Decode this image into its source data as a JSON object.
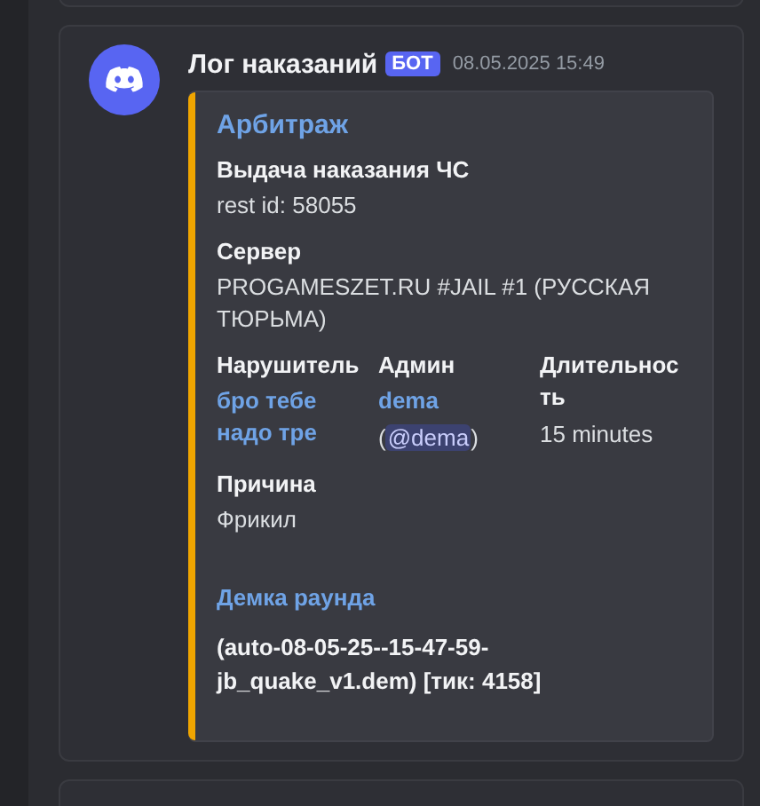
{
  "message": {
    "author": "Лог наказаний",
    "badge": "БОТ",
    "timestamp": "08.05.2025 15:49",
    "embed": {
      "color": "#f0a500",
      "title": "Арбитраж",
      "fields": [
        {
          "kind": "text",
          "name": "Выдача наказания ЧС",
          "value": "rest id: 58055"
        },
        {
          "kind": "text",
          "name": "Сервер",
          "value": "PROGAMESZET.RU #JAIL #1 (РУССКАЯ ТЮРЬМА)"
        },
        {
          "kind": "inline",
          "columns": [
            {
              "name": "Нарушитель",
              "link": "бро тебе надо тре"
            },
            {
              "name": "Админ",
              "link": "dema",
              "mention_open": "(",
              "mention": "@dema",
              "mention_close": ")"
            },
            {
              "name": "Длительность",
              "value": "15 minutes"
            }
          ]
        },
        {
          "kind": "text",
          "name": "Причина",
          "value": "Фрикил"
        },
        {
          "kind": "demo",
          "name": "Демка раунда",
          "value": "(auto-08-05-25--15-47-59-jb_quake_v1.dem) [тик: 4158]"
        }
      ]
    }
  }
}
